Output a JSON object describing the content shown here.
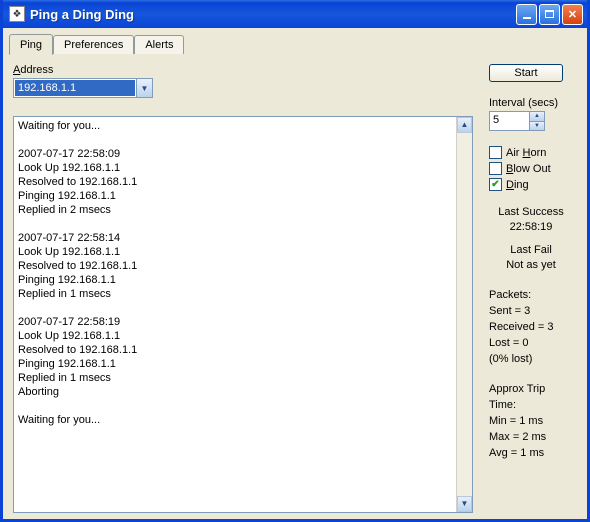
{
  "window": {
    "title": "Ping a Ding Ding"
  },
  "tabs": {
    "ping": "Ping",
    "preferences": "Preferences",
    "alerts": "Alerts"
  },
  "address": {
    "label": "Address",
    "value": "192.168.1.1"
  },
  "log_text": "Waiting for you...\n\n2007-07-17 22:58:09\nLook Up 192.168.1.1\nResolved to 192.168.1.1\nPinging 192.168.1.1\nReplied in 2 msecs\n\n2007-07-17 22:58:14\nLook Up 192.168.1.1\nResolved to 192.168.1.1\nPinging 192.168.1.1\nReplied in 1 msecs\n\n2007-07-17 22:58:19\nLook Up 192.168.1.1\nResolved to 192.168.1.1\nPinging 192.168.1.1\nReplied in 1 msecs\nAborting\n\nWaiting for you...",
  "start_button": "Start",
  "interval": {
    "label": "Interval (secs)",
    "value": "5"
  },
  "checks": {
    "air_horn": {
      "pre": "Air ",
      "u": "H",
      "post": "orn",
      "checked": false
    },
    "blow_out": {
      "pre": "",
      "u": "B",
      "post": "low Out",
      "checked": false
    },
    "ding": {
      "pre": "",
      "u": "D",
      "post": "ing",
      "checked": true
    }
  },
  "status": {
    "last_success_label": "Last Success",
    "last_success_value": "22:58:19",
    "last_fail_label": "Last Fail",
    "last_fail_value": "Not as yet"
  },
  "packets": {
    "header": "Packets:",
    "sent": "Sent = 3",
    "received": "Received = 3",
    "lost": "Lost = 0",
    "pct": "(0% lost)"
  },
  "trip": {
    "header": "Approx Trip Time:",
    "min": "Min = 1 ms",
    "max": "Max = 2 ms",
    "avg": "Avg = 1 ms"
  }
}
